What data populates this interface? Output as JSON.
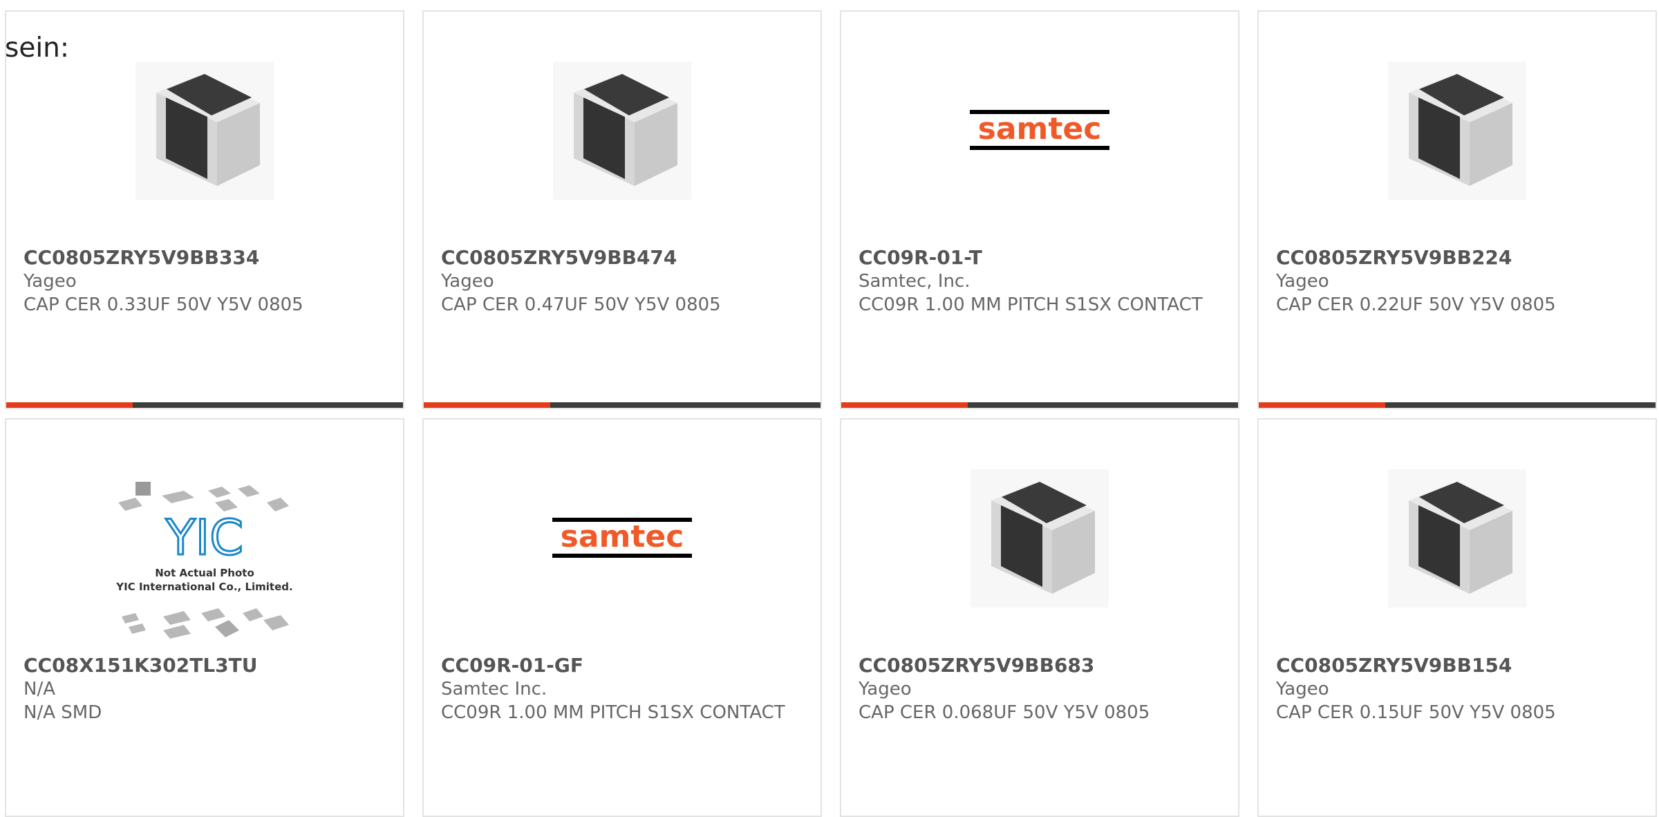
{
  "header_text": "sein:",
  "colors": {
    "accent": "#e43b1a",
    "bar_dark": "#3d3d3d",
    "samtec_orange": "#f05a28"
  },
  "image_types": [
    "smd-capacitor-chip",
    "samtec-logo",
    "yic-placeholder"
  ],
  "yic": {
    "line1": "Not Actual Photo",
    "line2": "YIC International Co., Limited.",
    "logo_text": "YIC"
  },
  "samtec_logo_text": "samtec",
  "products": [
    {
      "part": "CC0805ZRY5V9BB334",
      "mfr": "Yageo",
      "desc": "CAP CER 0.33UF 50V Y5V 0805",
      "image": "smd-capacitor-chip"
    },
    {
      "part": "CC0805ZRY5V9BB474",
      "mfr": "Yageo",
      "desc": "CAP CER 0.47UF 50V Y5V 0805",
      "image": "smd-capacitor-chip"
    },
    {
      "part": "CC09R-01-T",
      "mfr": "Samtec, Inc.",
      "desc": "CC09R 1.00 MM PITCH S1SX CONTACT",
      "image": "samtec-logo"
    },
    {
      "part": "CC0805ZRY5V9BB224",
      "mfr": "Yageo",
      "desc": "CAP CER 0.22UF 50V Y5V 0805",
      "image": "smd-capacitor-chip"
    },
    {
      "part": "CC08X151K302TL3TU",
      "mfr": "N/A",
      "desc": "N/A SMD",
      "image": "yic-placeholder"
    },
    {
      "part": "CC09R-01-GF",
      "mfr": "Samtec Inc.",
      "desc": "CC09R 1.00 MM PITCH S1SX CONTACT",
      "image": "samtec-logo"
    },
    {
      "part": "CC0805ZRY5V9BB683",
      "mfr": "Yageo",
      "desc": "CAP CER 0.068UF 50V Y5V 0805",
      "image": "smd-capacitor-chip"
    },
    {
      "part": "CC0805ZRY5V9BB154",
      "mfr": "Yageo",
      "desc": "CAP CER 0.15UF 50V Y5V 0805",
      "image": "smd-capacitor-chip"
    }
  ]
}
